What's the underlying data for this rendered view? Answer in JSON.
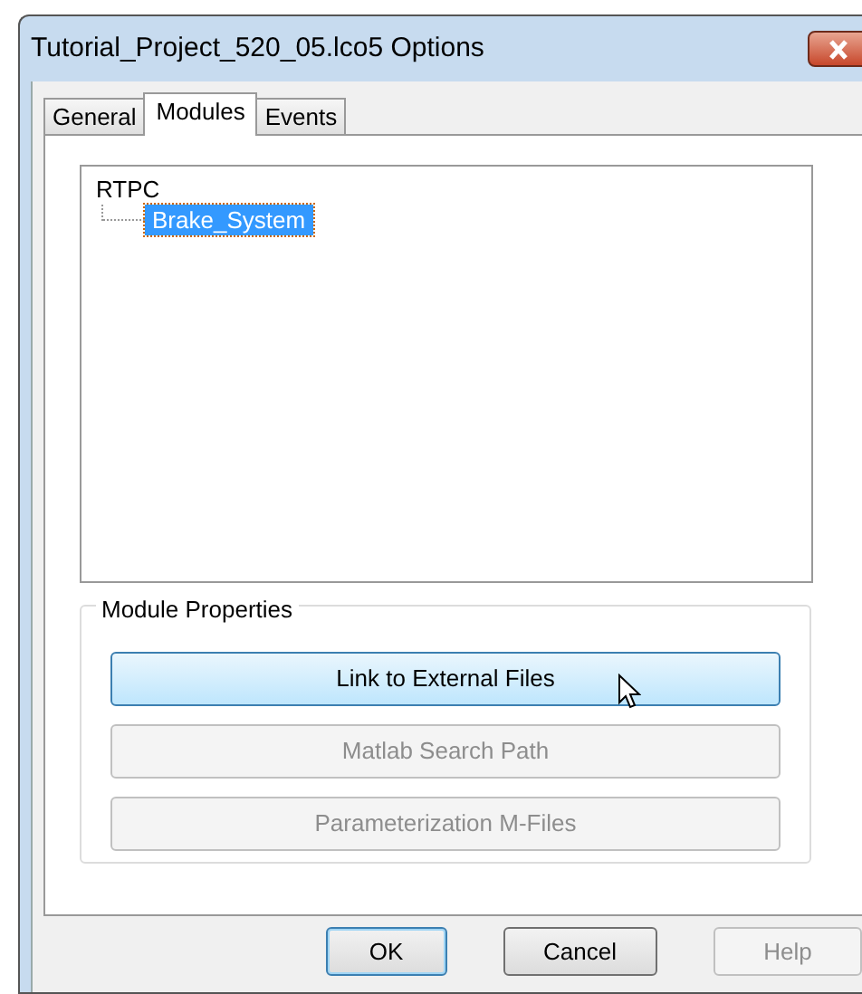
{
  "window": {
    "title": "Tutorial_Project_520_05.lco5 Options"
  },
  "tabs": [
    {
      "label": "General",
      "selected": false
    },
    {
      "label": "Modules",
      "selected": true
    },
    {
      "label": "Events",
      "selected": false
    }
  ],
  "tree": [
    {
      "label": "RTPC",
      "selected": false,
      "children": [
        {
          "label": "Brake_System",
          "selected": true
        }
      ]
    }
  ],
  "module_properties": {
    "title": "Module Properties",
    "buttons": [
      {
        "label": "Link to External Files",
        "disabled": false,
        "hovered": true
      },
      {
        "label": "Matlab Search Path",
        "disabled": true,
        "hovered": false
      },
      {
        "label": "Parameterization M-Files",
        "disabled": true,
        "hovered": false
      }
    ]
  },
  "footer_buttons": [
    {
      "label": "OK",
      "default": true,
      "disabled": false
    },
    {
      "label": "Cancel",
      "default": false,
      "disabled": false
    },
    {
      "label": "Help",
      "default": false,
      "disabled": true
    }
  ]
}
